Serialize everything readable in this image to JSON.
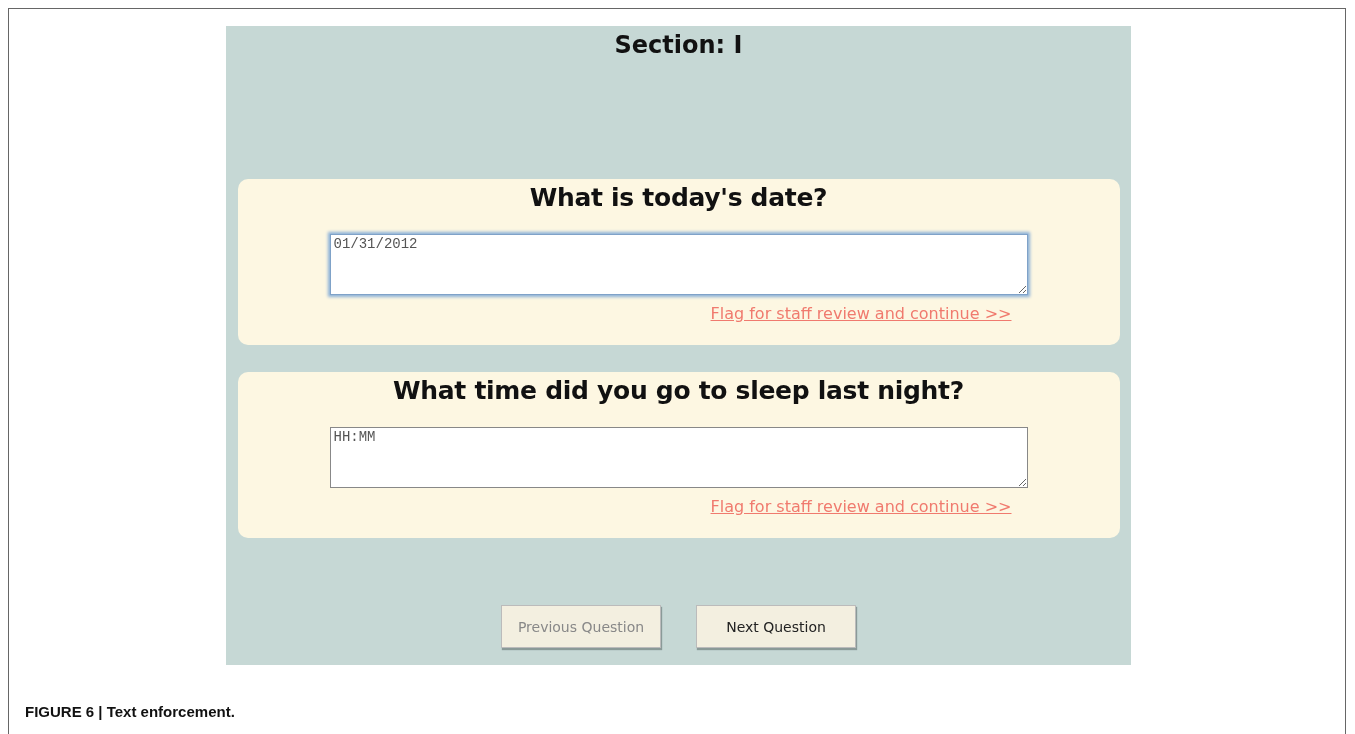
{
  "section_title": "Section: I",
  "questions": [
    {
      "prompt": "What is today's date?",
      "placeholder": "01/31/2012",
      "focused": true,
      "flag_link": "Flag for staff review and continue >>"
    },
    {
      "prompt": "What time did you go to sleep last night?",
      "placeholder": "HH:MM",
      "focused": false,
      "flag_link": "Flag for staff review and continue >>"
    }
  ],
  "buttons": [
    {
      "label": "Previous Question",
      "disabled": true
    },
    {
      "label": "Next Question",
      "disabled": false
    }
  ],
  "caption": "FIGURE 6 | Text enforcement."
}
